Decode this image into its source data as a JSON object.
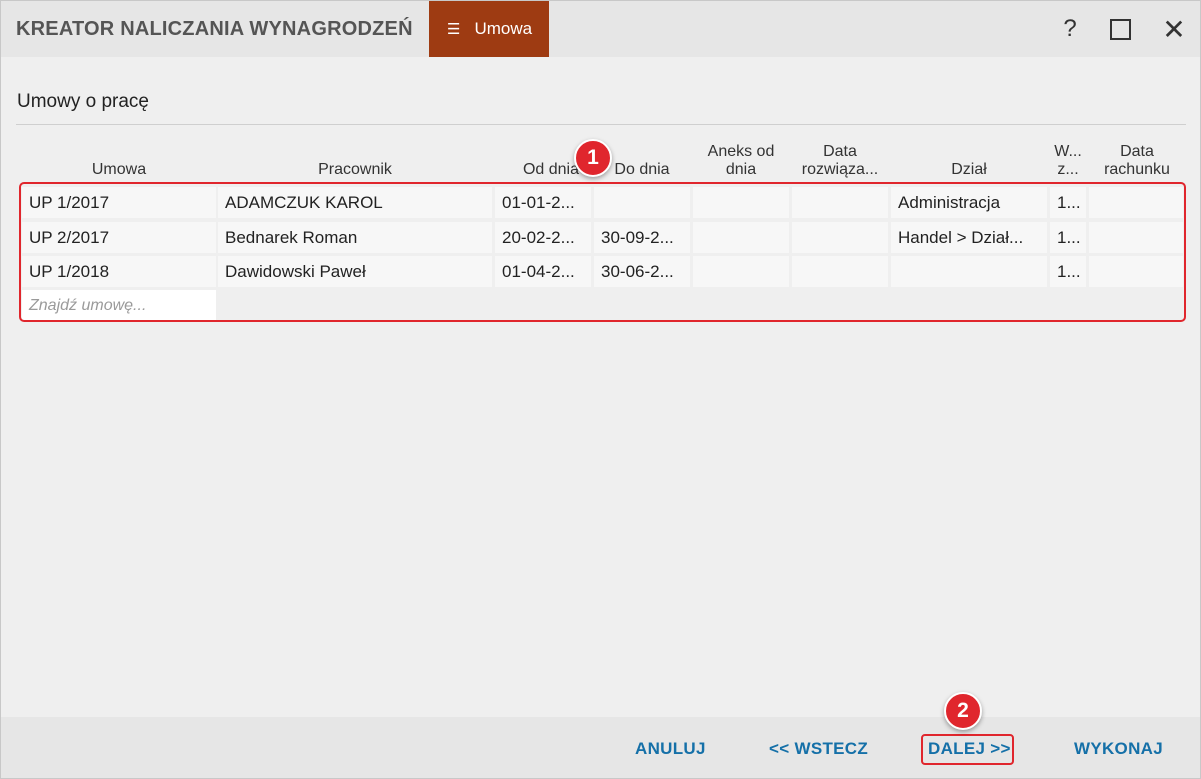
{
  "window": {
    "title": "KREATOR NALICZANIA WYNAGRODZEŃ",
    "mode_tab": {
      "icon": "menu-icon",
      "label": "Umowa"
    },
    "controls": {
      "help": "?",
      "maximize": "maximize-icon",
      "close": "✕"
    }
  },
  "section": {
    "title": "Umowy o pracę"
  },
  "grid": {
    "columns": [
      {
        "key": "umowa",
        "label": "Umowa"
      },
      {
        "key": "pracownik",
        "label": "Pracownik"
      },
      {
        "key": "od_dnia",
        "label": "Od dnia"
      },
      {
        "key": "do_dnia",
        "label": "Do dnia"
      },
      {
        "key": "aneks",
        "label": "Aneks od dnia"
      },
      {
        "key": "data_rozw",
        "label": "Data rozwiąza..."
      },
      {
        "key": "dzial",
        "label": "Dział"
      },
      {
        "key": "w",
        "label": "W... z..."
      },
      {
        "key": "data_rach",
        "label": "Data rachunku"
      }
    ],
    "rows": [
      [
        "UP 1/2017",
        "ADAMCZUK KAROL",
        "01-01-2...",
        "",
        "",
        "",
        "Administracja",
        "1...",
        ""
      ],
      [
        "UP 2/2017",
        "Bednarek Roman",
        "20-02-2...",
        "30-09-2...",
        "",
        "",
        "Handel > Dział...",
        "1...",
        ""
      ],
      [
        "UP 1/2018",
        "Dawidowski Paweł",
        "01-04-2...",
        "30-06-2...",
        "",
        "",
        "",
        "1...",
        ""
      ]
    ],
    "search_placeholder": "Znajdź umowę..."
  },
  "annotations": {
    "badge1": "1",
    "badge2": "2",
    "highlight_color": "#e0262d"
  },
  "footer": {
    "cancel": "ANULUJ",
    "back": "<< WSTECZ",
    "next": "DALEJ >>",
    "execute": "WYKONAJ"
  },
  "colors": {
    "accent_tab": "#9e3b12",
    "footer_link": "#1570a8"
  }
}
